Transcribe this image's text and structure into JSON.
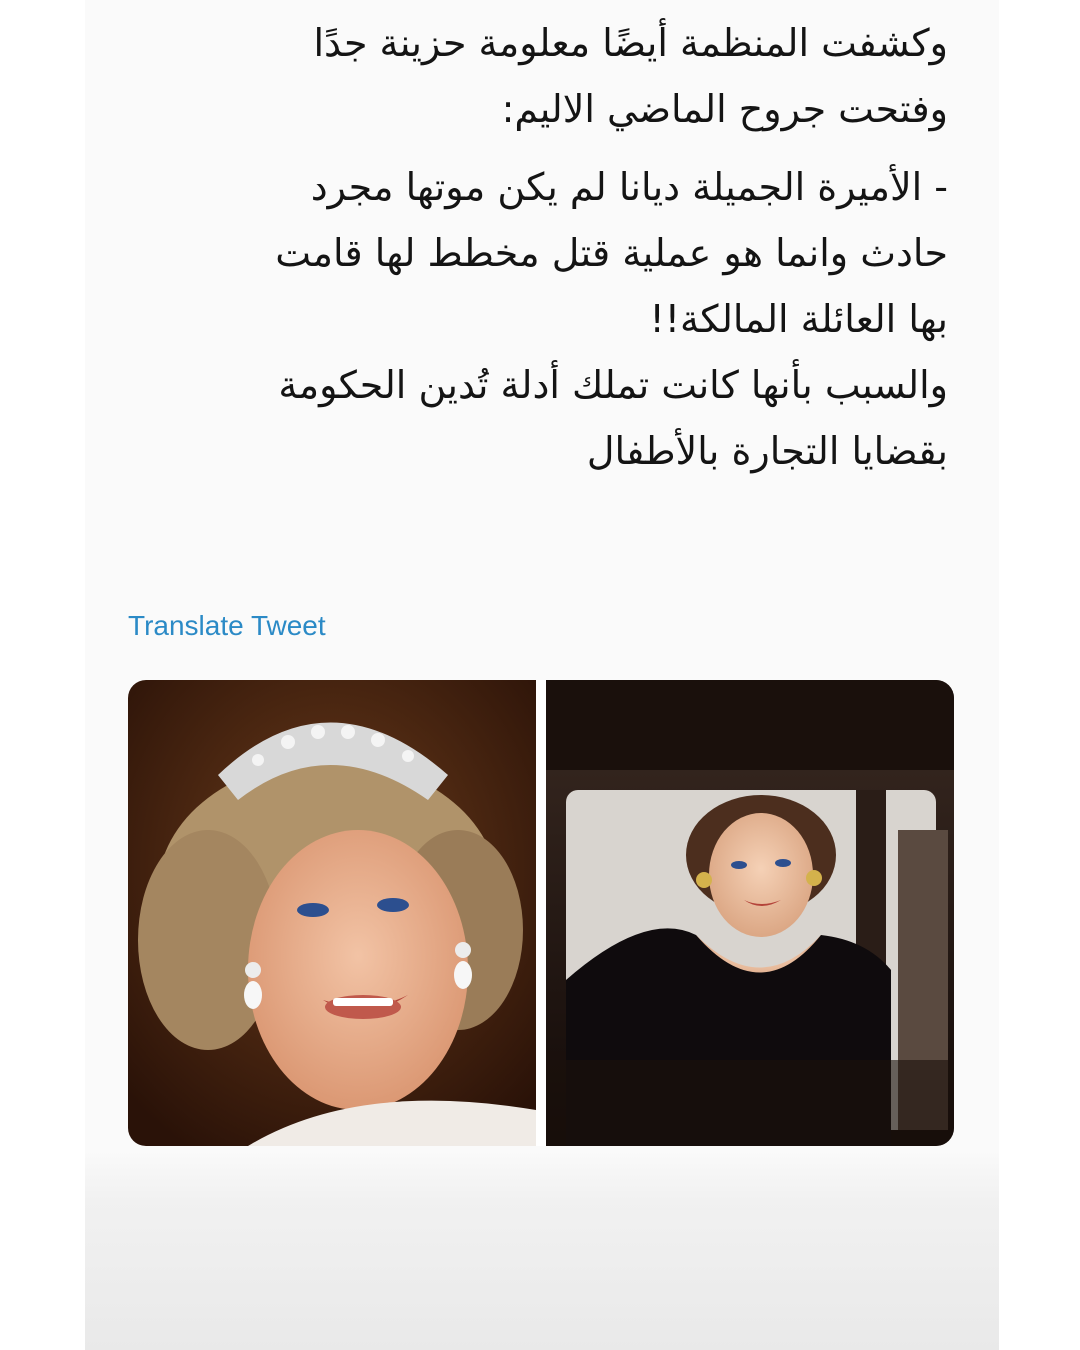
{
  "tweet": {
    "lines": [
      "وكشفت المنظمة أيضًا معلومة حزينة جدًا",
      "وفتحت جروح الماضي الاليم:",
      "- الأميرة الجميلة ديانا لم يكن موتها مجرد",
      "حادث وانما هو عملية قتل مخطط لها قامت",
      "بها العائلة المالكة!!",
      "والسبب بأنها كانت تملك أدلة تُدين الحكومة",
      "بقضايا التجارة بالأطفال"
    ],
    "translate_label": "Translate Tweet"
  },
  "media": {
    "photos": [
      {
        "subject": "woman-wearing-tiara-photo"
      },
      {
        "subject": "woman-in-car-window-photo"
      }
    ]
  },
  "colors": {
    "link": "#2b8ac6",
    "text": "#141414",
    "card_bg": "#fafafa"
  }
}
